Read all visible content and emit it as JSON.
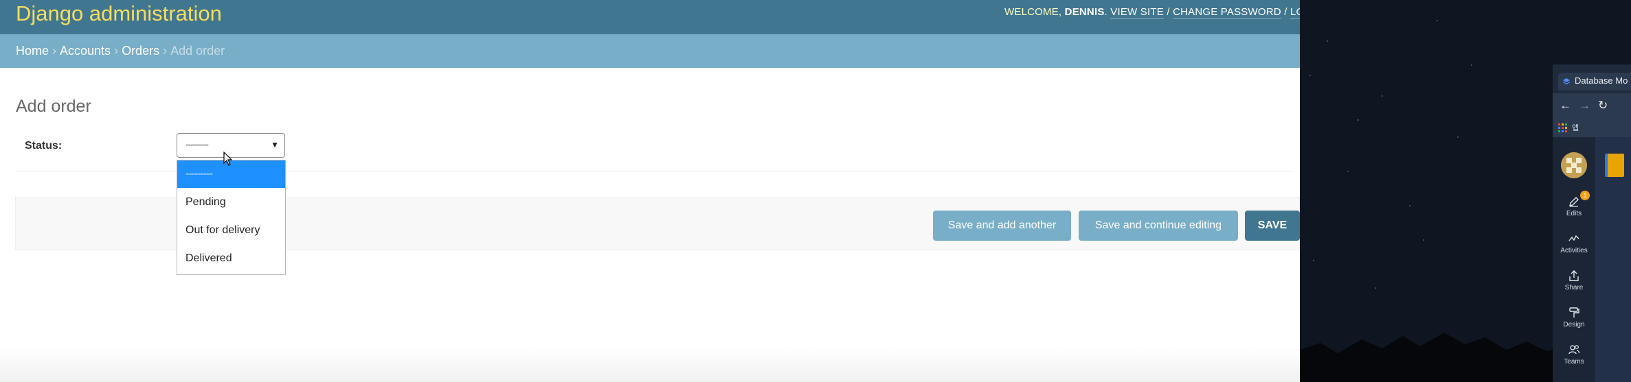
{
  "header": {
    "site_title": "Django administration",
    "welcome": "WELCOME,",
    "username": "DENNIS",
    "view_site": "VIEW SITE",
    "change_password": "CHANGE PASSWORD",
    "log_out": "LOG O",
    "separator": "/"
  },
  "breadcrumbs": {
    "home": "Home",
    "accounts": "Accounts",
    "orders": "Orders",
    "current": "Add order",
    "sep": "›"
  },
  "page": {
    "title": "Add order"
  },
  "form": {
    "status_label": "Status:",
    "status_value": "---------",
    "options": [
      "---------",
      "Pending",
      "Out for delivery",
      "Delivered"
    ],
    "selected_option_index": 0
  },
  "buttons": {
    "save_add_another": "Save and add another",
    "save_continue": "Save and continue editing",
    "save": "SAVE"
  },
  "browser": {
    "tab_title": "Database Mo",
    "bookmark_label": "앱",
    "sidebar": {
      "edits_label": "Edits",
      "edits_badge": "1",
      "activities_label": "Activities",
      "share_label": "Share",
      "design_label": "Design",
      "teams_label": "Teams"
    }
  },
  "colors": {
    "header_bg": "#417690",
    "title_yellow": "#f5dd5d",
    "breadcrumb_bg": "#79aec8",
    "button_light": "#79aec8",
    "button_dark": "#417690",
    "option_selected": "#1e90ff"
  }
}
